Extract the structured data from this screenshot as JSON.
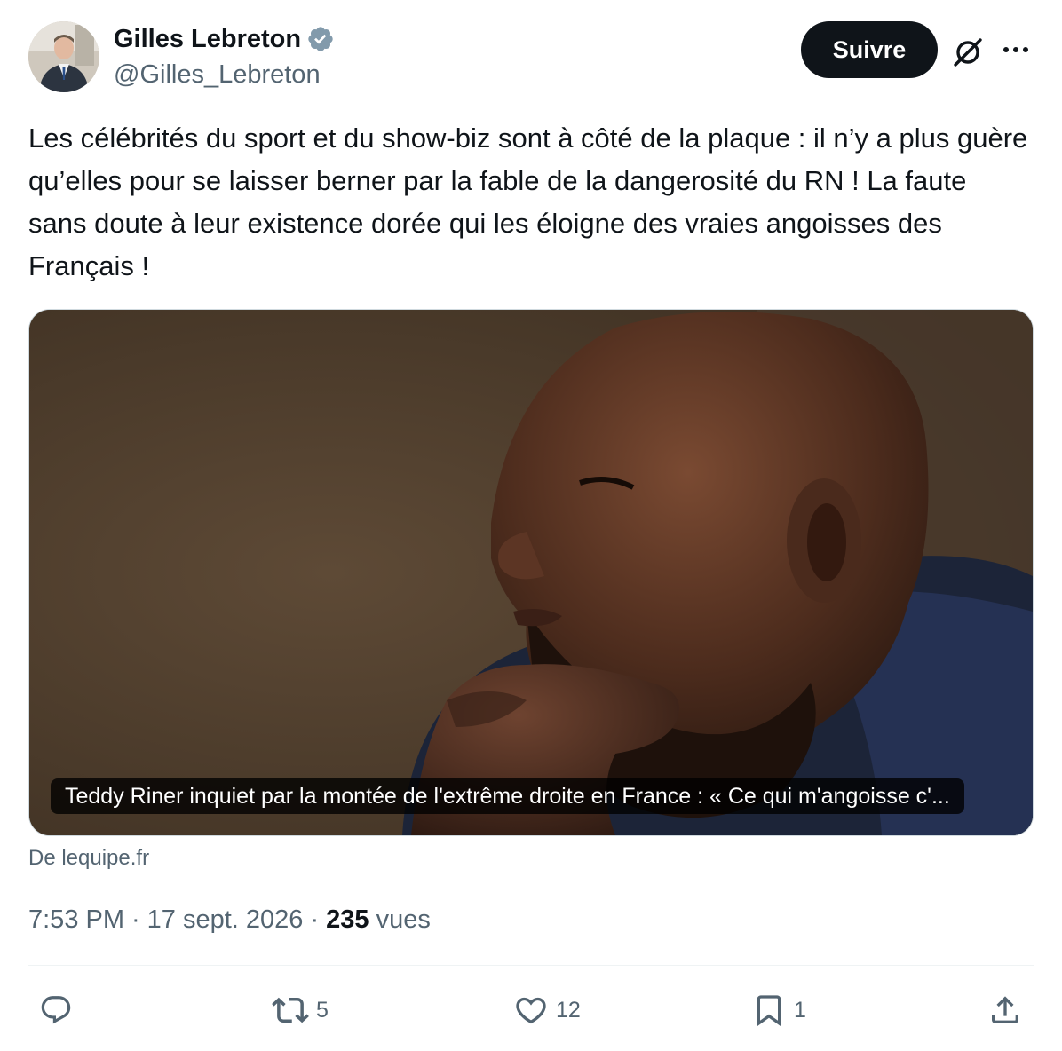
{
  "author": {
    "name": "Gilles Lebreton",
    "handle": "@Gilles_Lebreton",
    "verified": true,
    "verified_color": "#829aab"
  },
  "header": {
    "follow_label": "Suivre"
  },
  "tweet": {
    "text": "Les célébrités du sport et du show-biz sont à côté de la plaque : il n’y a plus guère qu’elles pour se laisser berner par la fable de la dangerosité du RN ! La faute sans doute à leur existence dorée qui les éloigne des vraies angoisses des Français !"
  },
  "card": {
    "caption": "Teddy Riner inquiet par la montée de l'extrême droite en France : « Ce qui m'angoisse c'...",
    "source": "De lequipe.fr"
  },
  "meta": {
    "time": "7:53 PM",
    "separator": "·",
    "date": "17 sept. 2026",
    "separator2": "·",
    "views_count": "235",
    "views_label": "vues"
  },
  "actions": {
    "reply_count": "",
    "retweet_count": "5",
    "like_count": "12",
    "bookmark_count": "1"
  },
  "colors": {
    "text": "#0f1419",
    "secondary": "#536471",
    "follow_bg": "#0f1419"
  }
}
